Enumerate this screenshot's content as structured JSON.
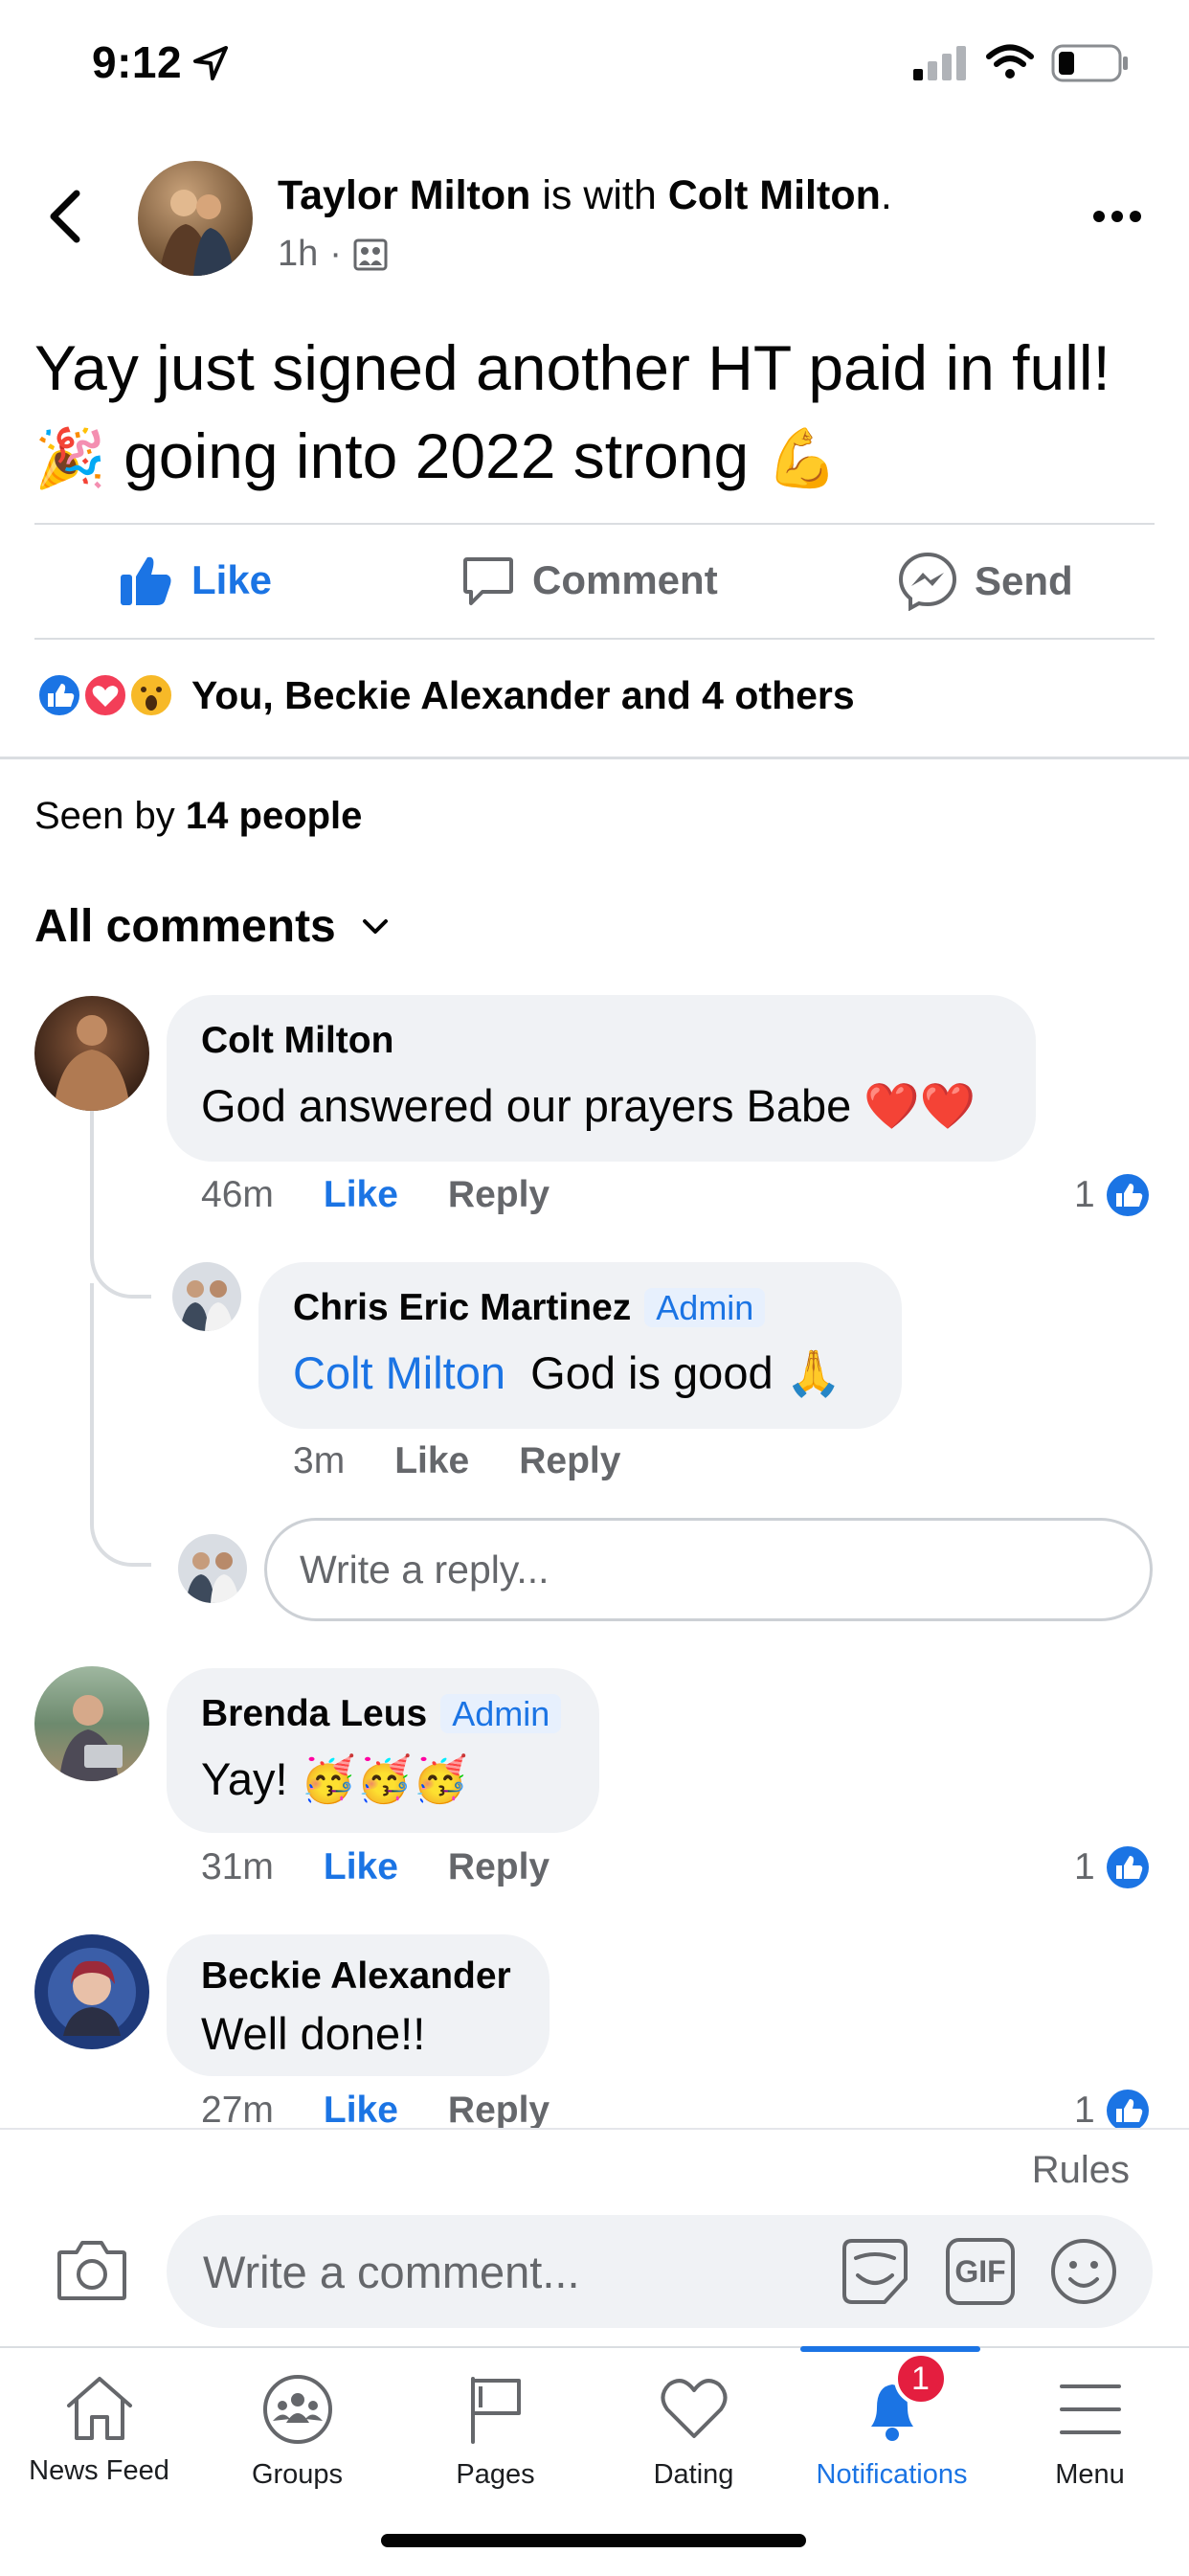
{
  "status_bar": {
    "time": "9:12"
  },
  "post": {
    "author": "Taylor Milton",
    "with_text": "is with",
    "tagged": "Colt Milton",
    "tagged_suffix": ".",
    "time": "1h",
    "text_line1": "Yay just signed another HT paid in full!",
    "text_line2": "going into 2022 strong",
    "emoji_party": "🎉",
    "emoji_muscle": "💪"
  },
  "actions": {
    "like": "Like",
    "comment": "Comment",
    "send": "Send"
  },
  "reactions": {
    "summary": "You, Beckie Alexander and 4 others"
  },
  "seen": {
    "prefix": "Seen by",
    "count": "14 people"
  },
  "comments_header": {
    "label": "All comments"
  },
  "comments": [
    {
      "name": "Colt Milton",
      "text": "God answered our prayers Babe",
      "emoji": "❤️❤️",
      "time": "46m",
      "like": "Like",
      "reply": "Reply",
      "like_count": "1"
    },
    {
      "name": "Brenda Leus",
      "badge": "Admin",
      "text": "Yay!",
      "emoji": "🥳🥳🥳",
      "time": "31m",
      "like": "Like",
      "reply": "Reply",
      "like_count": "1"
    },
    {
      "name": "Beckie Alexander",
      "text": "Well done!!",
      "time": "27m",
      "like": "Like",
      "reply": "Reply",
      "like_count": "1"
    }
  ],
  "reply": {
    "name": "Chris Eric Martinez",
    "badge": "Admin",
    "mention": "Colt Milton",
    "text": "God is good",
    "emoji": "🙏",
    "time": "3m",
    "like": "Like",
    "reply": "Reply"
  },
  "reply_input": {
    "placeholder": "Write a reply..."
  },
  "composer": {
    "rules": "Rules",
    "placeholder": "Write a comment...",
    "gif": "GIF"
  },
  "tabs": [
    {
      "label": "News Feed",
      "icon": "home-icon"
    },
    {
      "label": "Groups",
      "icon": "groups-icon"
    },
    {
      "label": "Pages",
      "icon": "flag-icon"
    },
    {
      "label": "Dating",
      "icon": "heart-icon"
    },
    {
      "label": "Notifications",
      "icon": "bell-icon",
      "badge": "1",
      "active": true
    },
    {
      "label": "Menu",
      "icon": "menu-icon"
    }
  ],
  "colors": {
    "accent": "#1b74e4",
    "badge_red": "#e41e3f",
    "bubble": "#f0f2f5"
  }
}
